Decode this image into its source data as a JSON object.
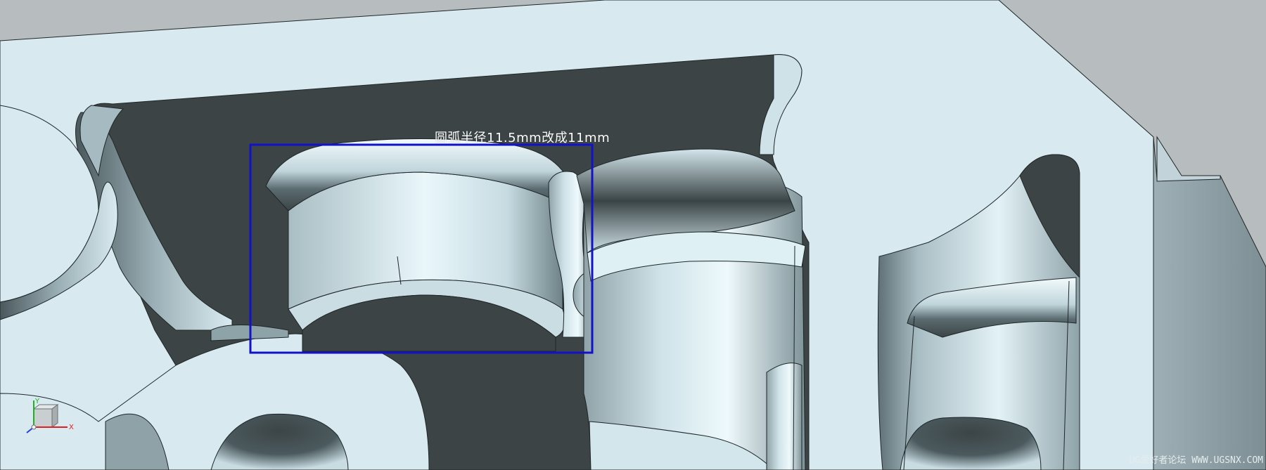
{
  "annotation": {
    "text": "圆弧半径11.5mm改成11mm",
    "box_color": "#1212c8"
  },
  "watermark": {
    "text": "UG爱好者论坛 WWW.UGSNX.COM"
  },
  "triad": {
    "x_label": "X",
    "y_label": "Y",
    "z_label": "Z",
    "x_color": "#e02020",
    "y_color": "#20b020",
    "z_color": "#2040e0"
  },
  "colors": {
    "background": "#b7bcbf",
    "part_face": "#d8eaf0",
    "cavity_floor": "#3c4446",
    "edge_line": "#1e2628"
  }
}
